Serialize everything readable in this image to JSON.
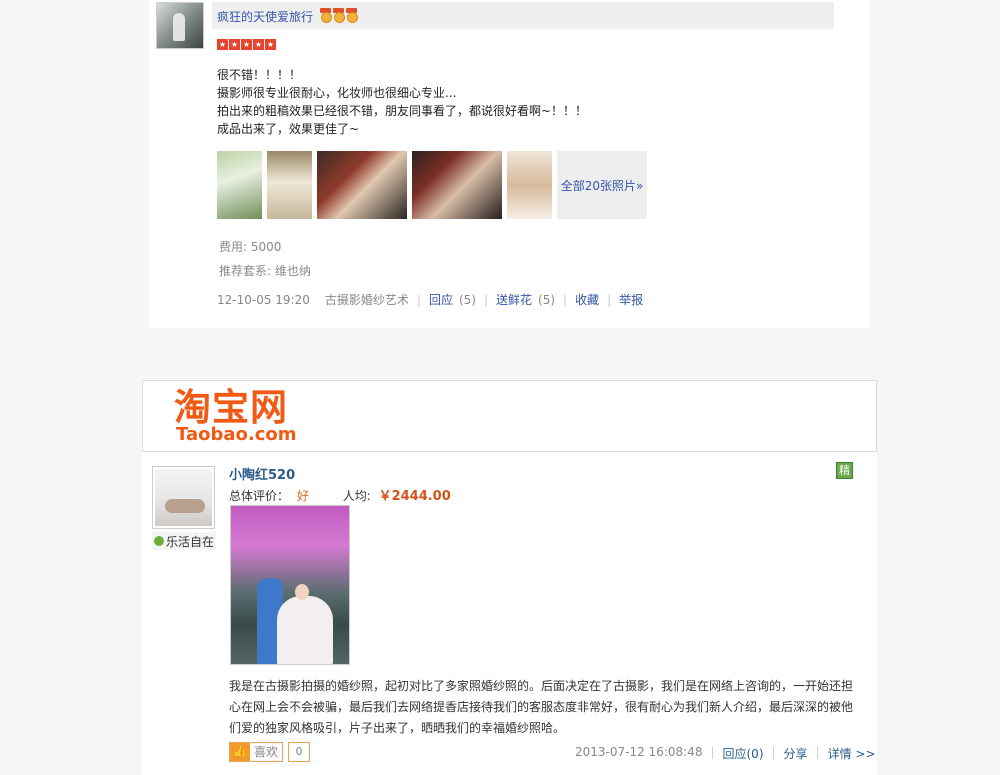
{
  "review1": {
    "username": "疯狂的天使爱旅行",
    "medal_icons": [
      "medal-icon",
      "medal-icon",
      "medal-icon"
    ],
    "rating_stars": 5,
    "content_lines": [
      "很不错！！！！",
      "摄影师很专业很耐心，化妆师也很细心专业...",
      "拍出来的粗稿效果已经很不错，朋友同事看了，都说很好看啊~！！！",
      "成品出来了，效果更佳了~"
    ],
    "more_photos_label": "全部20张照片»",
    "fee": "费用: 5000",
    "package": "推荐套系: 维也纳",
    "meta": {
      "datetime": "12-10-05 19:20",
      "shop": "古摄影婚纱艺术",
      "reply_label": "回应",
      "reply_count": "(5)",
      "flower_label": "送鲜花",
      "flower_count": "(5)",
      "favorite_label": "收藏",
      "report_label": "举报"
    }
  },
  "taobao": {
    "logo_cn": "淘宝网",
    "logo_en": "Taobao.com"
  },
  "review2": {
    "username": "小陶红520",
    "nickname": "乐活自在",
    "badge": "精",
    "rating_label": "总体评价：",
    "rating_value": "好",
    "avg_label": "人均:",
    "avg_price": "￥2444.00",
    "content": "我是在古摄影拍摄的婚纱照，起初对比了多家照婚纱照的。后面决定在了古摄影，我们是在网络上咨询的，一开始还担心在网上会不会被骗，最后我们去网络提香店接待我们的客服态度非常好，很有耐心为我们新人介绍，最后深深的被他们爱的独家风格吸引，片子出来了，晒晒我们的幸福婚纱照哈。",
    "like_label": "喜欢",
    "like_count": "0",
    "datetime": "2013-07-12 16:08:48",
    "reply_label": "回应(0)",
    "share_label": "分享",
    "detail_label": "详情 >>"
  }
}
